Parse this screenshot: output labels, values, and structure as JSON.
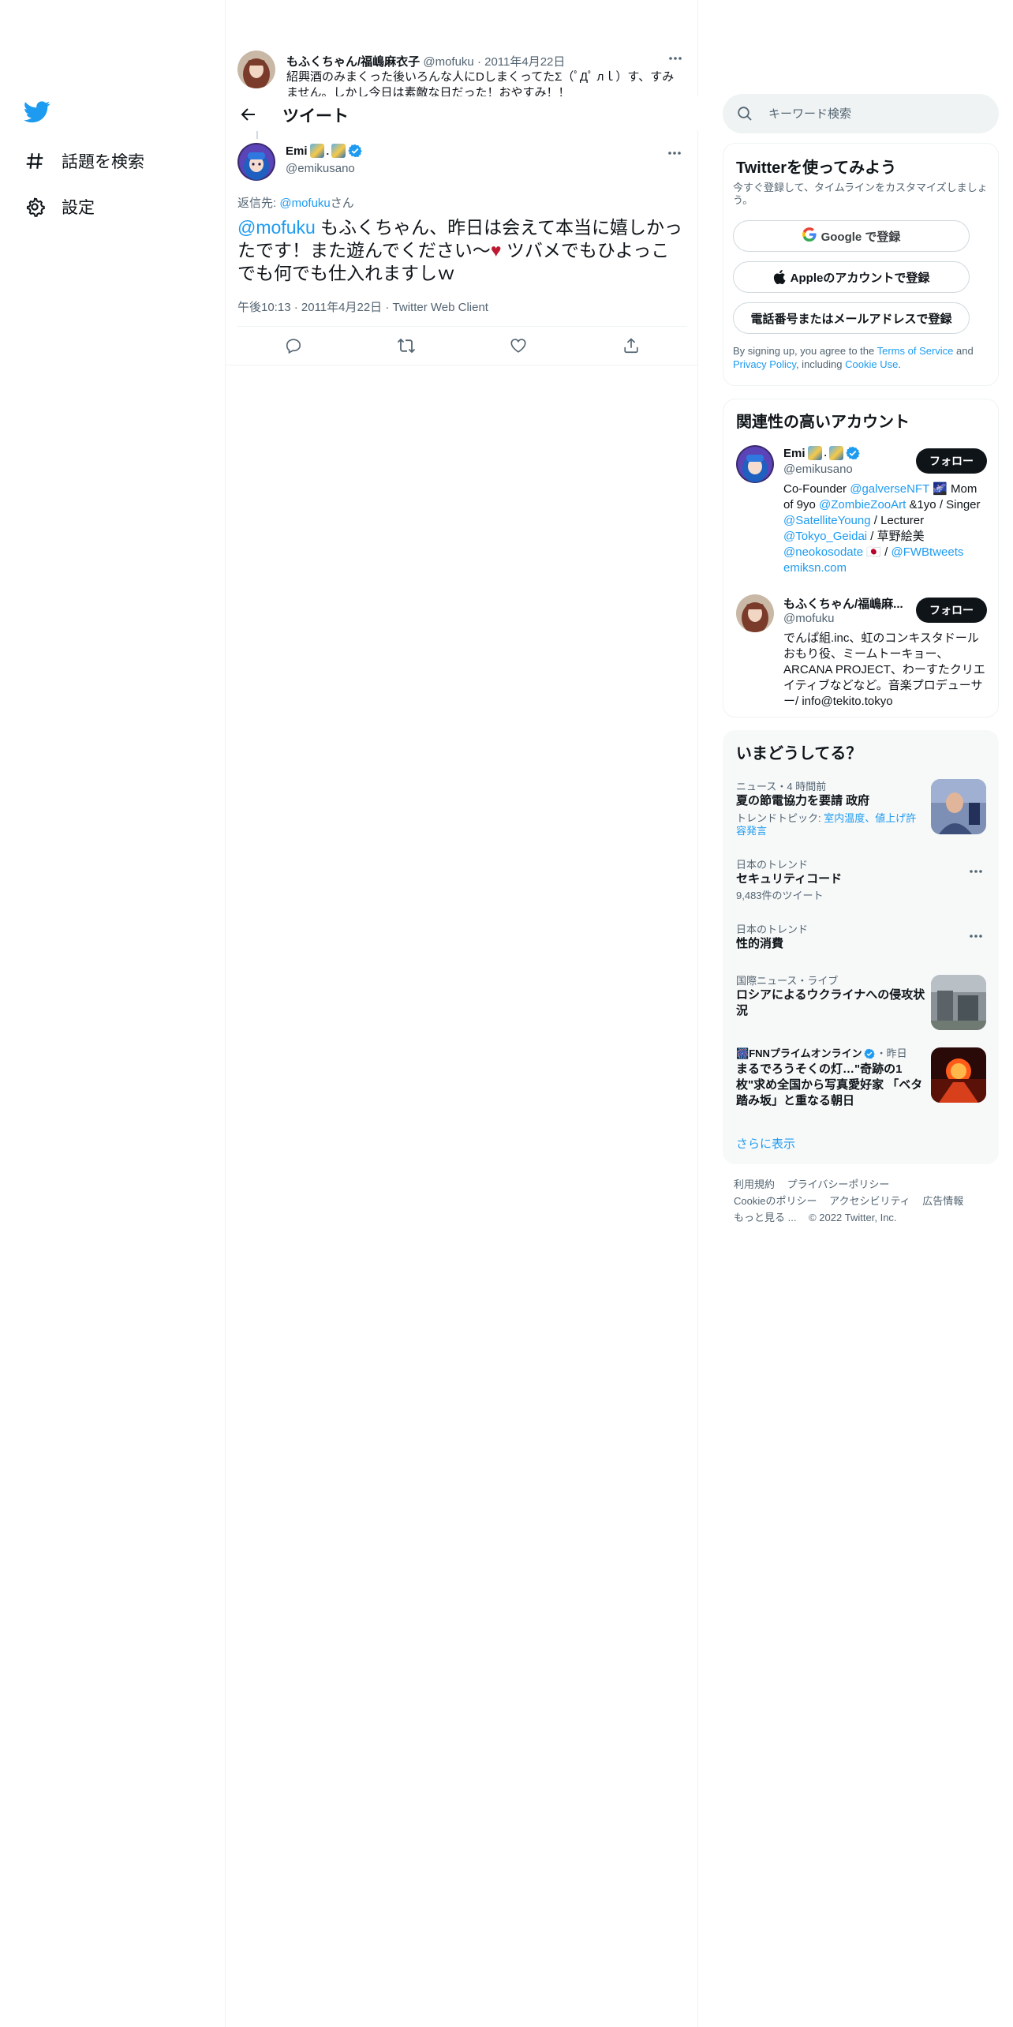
{
  "leftnav": {
    "explore_label": "話題を検索",
    "settings_label": "設定"
  },
  "parent_tweet": {
    "name": "もふくちゃん/福嶋麻衣子",
    "handle": "@mofuku",
    "date": "2011年4月22日",
    "text": "紹興酒のみまくった後いろんな人にDしまくってたΣ（ﾟДﾟ лｌ）す、すみません。しかし今日は素敵な日だった！おやすみ！！"
  },
  "header": {
    "title": "ツイート"
  },
  "tweet": {
    "name": "Emi",
    "handle": "@emikusano",
    "reply_prefix": "返信先: ",
    "reply_to": "@mofuku",
    "reply_suffix": "さん",
    "mention": "@mofuku",
    "text_part1": " もふくちゃん、昨日は会えて本当に嬉しかったです！また遊んでください〜",
    "heart": "♥",
    "text_part2": " ツバメでもひよっこでも何でも仕入れますしｗ",
    "time": "午後10:13",
    "date": "2011年4月22日",
    "client": "Twitter Web Client"
  },
  "search": {
    "placeholder": "キーワード検索"
  },
  "signup": {
    "title": "Twitterを使ってみよう",
    "subtitle": "今すぐ登録して、タイムラインをカスタマイズしましょう。",
    "google_g": "G",
    "google_label": "Google で登録",
    "apple_label": "Appleのアカウントで登録",
    "phone_label": "電話番号またはメールアドレスで登録",
    "legal_1": "By signing up, you agree to the ",
    "terms": "Terms of Service",
    "legal_2": " and ",
    "privacy": "Privacy Policy",
    "legal_3": ", including ",
    "cookie": "Cookie Use",
    "legal_4": "."
  },
  "related": {
    "title": "関連性の高いアカウント",
    "follow_label": "フォロー",
    "accounts": [
      {
        "name": "Emi",
        "handle": "@emikusano",
        "bio_1": "Co-Founder ",
        "bio_l1": "@galverseNFT",
        "bio_2": " 🌌 Mom of 9yo ",
        "bio_l2": "@ZombieZooArt",
        "bio_3": " &1yo / Singer ",
        "bio_l3": "@SatelliteYoung",
        "bio_4": " / Lecturer ",
        "bio_l4": "@Tokyo_Geidai",
        "bio_5": " / 草野絵美 ",
        "bio_l5": "@neokosodate",
        "bio_6": " 🇯🇵 / ",
        "bio_l6": "@FWBtweets",
        "bio_l7": "emiksn.com"
      },
      {
        "name": "もふくちゃん/福嶋麻...",
        "handle": "@mofuku",
        "bio": "でんぱ組.inc、虹のコンキスタドールおもり役、ミームトーキョー、ARCANA PROJECT、わーすたクリエイティブなどなど。音楽プロデューサー/ info@tekito.tokyo"
      }
    ]
  },
  "trends": {
    "title": "いまどうしてる？",
    "items": [
      {
        "context": "ニュース・4 時間前",
        "title": "夏の節電協力を要請 政府",
        "sub_prefix": "トレンドトピック: ",
        "sub_links": "室内温度、値上げ許容発言"
      },
      {
        "context": "日本のトレンド",
        "title": "セキュリティコード",
        "count": "9,483件のツイート"
      },
      {
        "context": "日本のトレンド",
        "title": "性的消費"
      },
      {
        "context": "国際ニュース・ライブ",
        "title": "ロシアによるウクライナへの侵攻状況"
      },
      {
        "context_prefix": "🎆 ",
        "context": "FNNプライムオンライン",
        "context_suffix": "・昨日",
        "title": "まるでろうそくの灯…\"奇跡の1枚\"求め全国から写真愛好家 「ベタ踏み坂」と重なる朝日"
      }
    ],
    "show_more": "さらに表示"
  },
  "footer": {
    "terms": "利用規約",
    "privacy": "プライバシーポリシー",
    "cookie": "Cookieのポリシー",
    "accessibility": "アクセシビリティ",
    "ads": "広告情報",
    "more": "もっと見る ...",
    "copyright": "© 2022 Twitter, Inc."
  },
  "colors": {
    "accent": "#1d9bf0",
    "text": "#0f1419",
    "muted": "#536471",
    "border": "#eff3f4"
  }
}
